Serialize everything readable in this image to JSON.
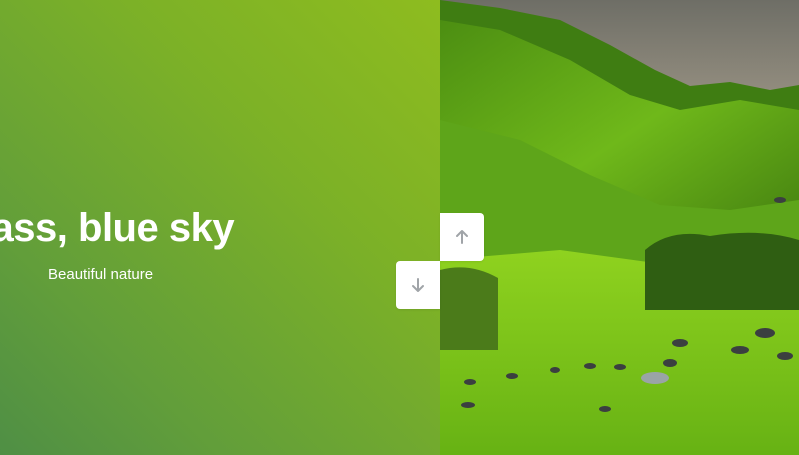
{
  "slide": {
    "title": "n grass, blue sky",
    "subtitle": "Beautiful nature"
  },
  "image": {
    "description_icon": "landscape-photo"
  },
  "controls": {
    "up_icon": "arrow-up-icon",
    "down_icon": "arrow-down-icon"
  },
  "colors": {
    "panel_gradient_top": "#8ebc1f",
    "panel_gradient_bottom": "#4f8f45",
    "button_bg": "#ffffff",
    "arrow": "#a0a4a8"
  }
}
